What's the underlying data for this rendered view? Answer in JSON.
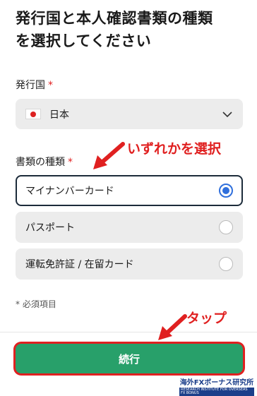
{
  "page": {
    "title": "発行国と本人確認書類の種類\nを選択してください"
  },
  "country": {
    "label": "発行国",
    "required_mark": "*",
    "value": "日本",
    "flag_icon": "japan-flag-icon"
  },
  "document_type": {
    "label": "書類の種類",
    "required_mark": "*",
    "options": [
      {
        "label": "マイナンバーカード",
        "selected": true
      },
      {
        "label": "パスポート",
        "selected": false
      },
      {
        "label": "運転免許証 / 在留カード",
        "selected": false
      }
    ]
  },
  "required_note": "* 必須項目",
  "continue_button": {
    "label": "続行",
    "color": "#28a06a"
  },
  "annotations": {
    "select_hint": "いずれかを選択",
    "tap_hint": "タップ",
    "color": "#e02020"
  },
  "watermark": {
    "main": "海外FXボーナス研究所",
    "sub": "RESEARCH INSTITUTE FOR OVERSEAS FX BONUS"
  }
}
